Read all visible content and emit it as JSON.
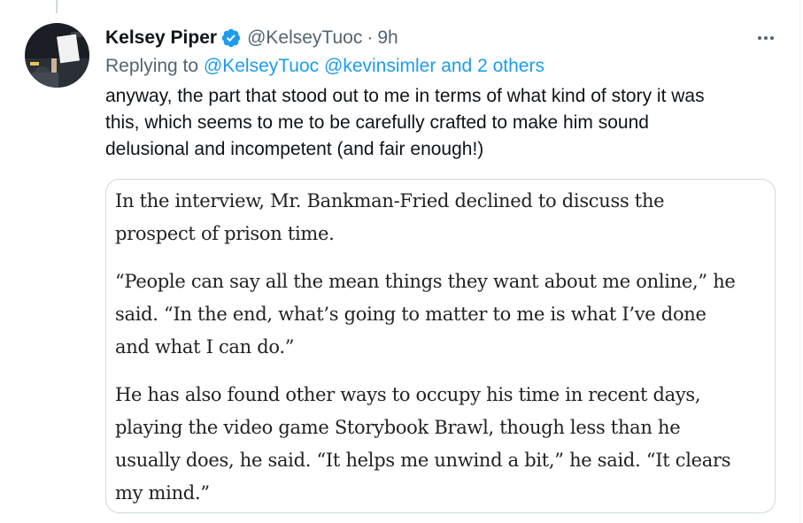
{
  "tweet": {
    "author_name": "Kelsey Piper",
    "handle": "@KelseyTuoc",
    "separator": "·",
    "time": "9h",
    "replying_prefix": "Replying to",
    "reply_to_1": "@KelseyTuoc",
    "reply_to_2": "@kevinsimler",
    "reply_to_more": "and 2 others",
    "text_lines": [
      "anyway, the part that stood out to me in terms of what kind of story it was",
      "this, which seems to me to be carefully crafted to make him sound",
      "delusional and incompetent (and fair enough!)"
    ],
    "verified_icon": "verified-badge-icon",
    "more_icon": "more-options-icon",
    "avatar_icon": "profile-photo"
  },
  "quote": {
    "paragraphs": [
      {
        "lines": [
          "In the interview, Mr. Bankman-Fried declined to discuss the",
          "prospect of prison time."
        ]
      },
      {
        "lines": [
          "“People can say all the mean things they want about me online,” he",
          "said. “In the end, what’s going to matter to me is what I’ve done",
          "and what I can do.”"
        ]
      },
      {
        "lines": [
          "He has also found other ways to occupy his time in recent days,",
          "playing the video game Storybook Brawl, though less than he",
          "usually does, he said. “It helps me unwind a bit,” he said. “It clears",
          "my mind.”"
        ]
      }
    ]
  },
  "colors": {
    "accent": "#1d9bf0",
    "secondary_text": "#536471",
    "primary_text": "#0f1419",
    "border": "#cfd9de"
  }
}
